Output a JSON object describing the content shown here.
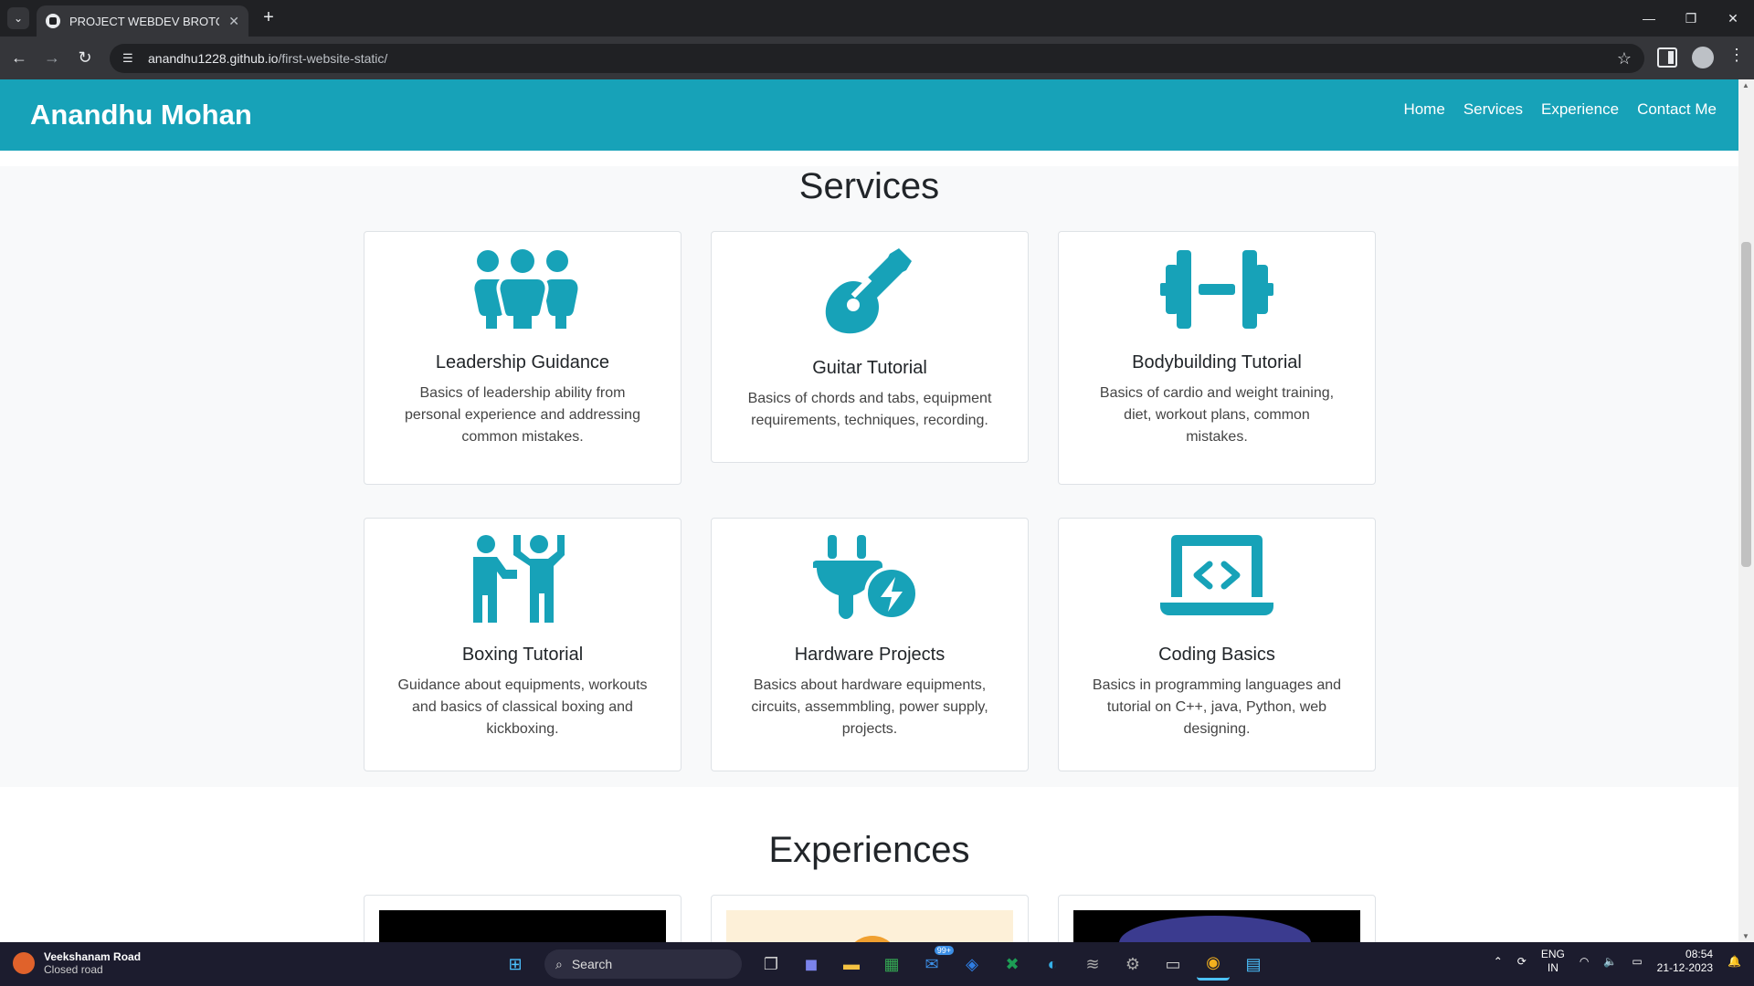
{
  "browser": {
    "tab_title": "PROJECT WEBDEV BROTOTYPE",
    "url_host": "anandhu1228.github.io",
    "url_path": "/first-website-static/"
  },
  "site": {
    "brand": "Anandhu Mohan",
    "nav": [
      "Home",
      "Services",
      "Experience",
      "Contact Me"
    ],
    "accent_color": "#17a2b8"
  },
  "services": {
    "title": "Services",
    "cards": [
      {
        "icon": "people-group-icon",
        "title": "Leadership Guidance",
        "text": "Basics of leadership ability from personal experience and addressing common mistakes."
      },
      {
        "icon": "guitar-icon",
        "title": "Guitar Tutorial",
        "text": "Basics of chords and tabs, equipment requirements, techniques, recording."
      },
      {
        "icon": "dumbbell-icon",
        "title": "Bodybuilding Tutorial",
        "text": "Basics of cardio and weight training, diet, workout plans, common mistakes."
      },
      {
        "icon": "boxing-people-icon",
        "title": "Boxing Tutorial",
        "text": "Guidance about equipments, workouts and basics of classical boxing and kickboxing."
      },
      {
        "icon": "plug-bolt-icon",
        "title": "Hardware Projects",
        "text": "Basics about hardware equipments, circuits, assemmbling, power supply, projects."
      },
      {
        "icon": "laptop-code-icon",
        "title": "Coding Basics",
        "text": "Basics in programming languages and tutorial on C++, java, Python, web designing."
      }
    ]
  },
  "experiences": {
    "title": "Experiences"
  },
  "taskbar": {
    "weather_title": "Veekshanam Road",
    "weather_sub": "Closed road",
    "search": "Search",
    "mail_badge": "99+",
    "lang1": "ENG",
    "lang2": "IN",
    "time": "08:54",
    "date": "21-12-2023"
  }
}
